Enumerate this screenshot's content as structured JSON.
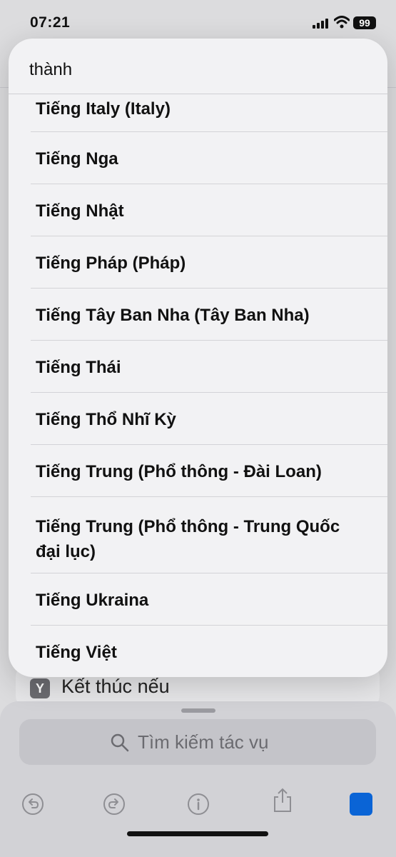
{
  "status_bar": {
    "time": "07:21",
    "battery": "99"
  },
  "popup": {
    "search_value": "thành",
    "items": [
      "Tiếng Italy (Italy)",
      "Tiếng Nga",
      "Tiếng Nhật",
      "Tiếng Pháp (Pháp)",
      "Tiếng Tây Ban Nha (Tây Ban Nha)",
      "Tiếng Thái",
      "Tiếng Thổ Nhĩ Kỳ",
      "Tiếng Trung (Phổ thông - Đài Loan)",
      "Tiếng Trung (Phổ thông - Trung Quốc đại lục)",
      "Tiếng Ukraina",
      "Tiếng Việt"
    ]
  },
  "background": {
    "card_label": "Kết thúc nếu",
    "search_placeholder": "Tìm kiếm tác vụ"
  },
  "colors": {
    "accent": "#0a64d6"
  }
}
